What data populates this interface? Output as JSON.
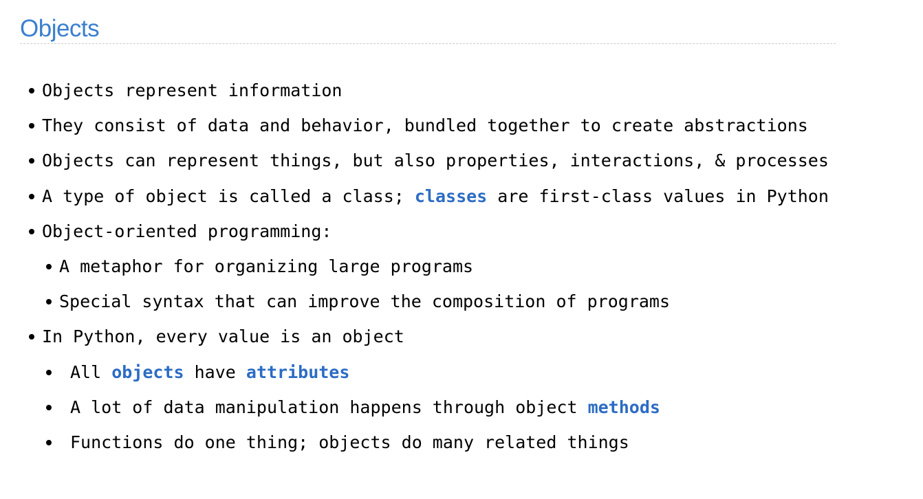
{
  "title": "Objects",
  "bullets": {
    "b1": "Objects represent information",
    "b2": "They consist of data and behavior, bundled together to create abstractions",
    "b3": "Objects can represent things, but also properties, interactions, & processes",
    "b4": {
      "before": "A type of object is called a class; ",
      "keyword": "classes",
      "after": " are first-class values in Python"
    },
    "b5": "Object-oriented programming:",
    "b5_sub": {
      "s1": "A metaphor for organizing large programs",
      "s2": "Special syntax that can improve the composition of programs"
    },
    "b6": "In Python, every value is an object",
    "b6_sub": {
      "s1": {
        "before": "All ",
        "keyword1": "objects",
        "middle": " have ",
        "keyword2": "attributes"
      },
      "s2": {
        "before": "A lot of data manipulation happens through object ",
        "keyword": "methods"
      },
      "s3": "Functions do one thing; objects do many related things"
    }
  },
  "colors": {
    "title": "#3a7fcf",
    "keyword": "#2c6cc4",
    "text": "#000000",
    "rule": "#c9c9c9"
  }
}
